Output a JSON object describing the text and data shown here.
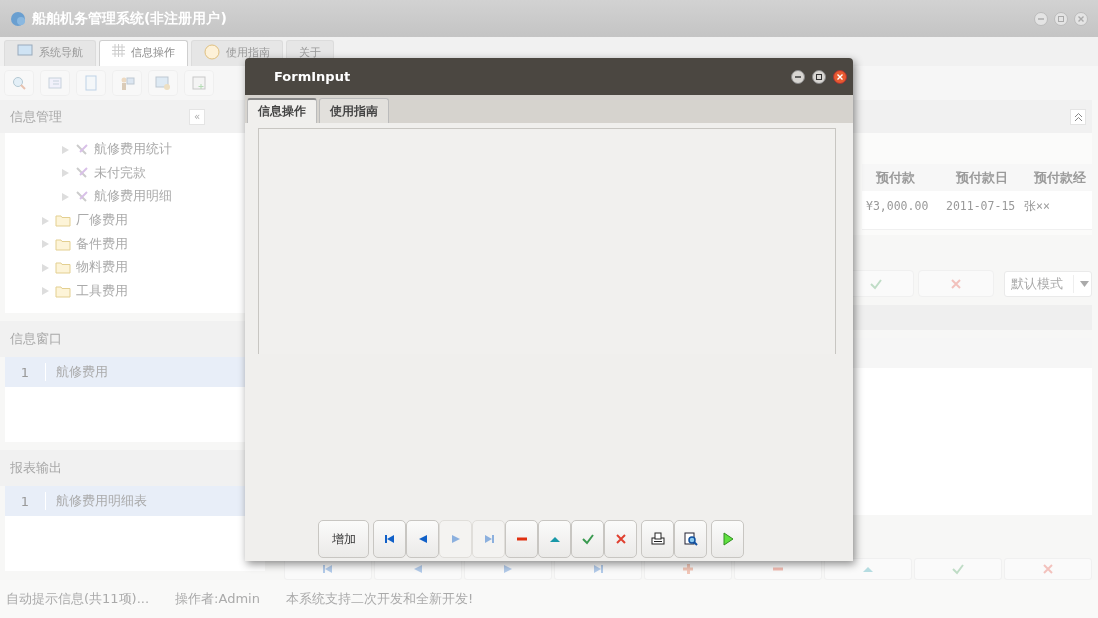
{
  "window": {
    "title": "船舶机务管理系统(非注册用户)"
  },
  "tabs": [
    {
      "label": "系统导航",
      "selected": false,
      "kind": "monitor"
    },
    {
      "label": "信息操作",
      "selected": true,
      "kind": "grid"
    },
    {
      "label": "使用指南",
      "selected": false,
      "kind": "clock"
    },
    {
      "label": "关于",
      "selected": false,
      "kind": "none"
    }
  ],
  "sidebar": {
    "title": "信息管理",
    "collapse_label": "«",
    "tree": [
      {
        "children": [
          {
            "label": "航修费用统计",
            "kind": "tool",
            "expanded": false
          },
          {
            "label": "未付完款",
            "kind": "tool",
            "expanded": false
          },
          {
            "label": "航修费用明细",
            "kind": "tool",
            "expanded": false
          }
        ]
      },
      {
        "label": "厂修费用",
        "kind": "folder",
        "expanded": false
      },
      {
        "label": "备件费用",
        "kind": "folder",
        "expanded": false
      },
      {
        "label": "物料费用",
        "kind": "folder",
        "expanded": false
      },
      {
        "label": "工具费用",
        "kind": "folder",
        "expanded": false
      }
    ]
  },
  "info_window": {
    "title": "信息窗口",
    "rows": [
      {
        "index": "1",
        "label": "航修费用",
        "selected": true
      }
    ]
  },
  "report_output": {
    "title": "报表输出",
    "rows": [
      {
        "index": "1",
        "label": "航修费用明细表",
        "selected": true
      }
    ]
  },
  "table": {
    "columns": [
      "预付款",
      "预付款日",
      "预付款经"
    ],
    "rows": [
      [
        "¥3,000.00",
        "2011-07-15",
        "张××"
      ]
    ]
  },
  "mode_select": {
    "value": "默认模式"
  },
  "dialog": {
    "title": "FormInput",
    "tabs": [
      {
        "label": "信息操作",
        "selected": true
      },
      {
        "label": "使用指南",
        "selected": false
      }
    ],
    "toolbar": [
      {
        "kind": "text",
        "label": "增加",
        "disabled": false
      },
      {
        "kind": "first",
        "disabled": false
      },
      {
        "kind": "prev",
        "disabled": false
      },
      {
        "kind": "next",
        "disabled": true
      },
      {
        "kind": "last",
        "disabled": true
      },
      {
        "kind": "minus",
        "disabled": false
      },
      {
        "kind": "up",
        "disabled": false
      },
      {
        "kind": "check",
        "disabled": false
      },
      {
        "kind": "cross",
        "disabled": false
      },
      {
        "kind": "print",
        "disabled": false
      },
      {
        "kind": "preview",
        "disabled": false
      },
      {
        "kind": "play",
        "disabled": false
      }
    ]
  },
  "status_bar": [
    "自动提示信息(共11项)...",
    "操作者:Admin",
    "本系统支持二次开发和全新开发!"
  ]
}
